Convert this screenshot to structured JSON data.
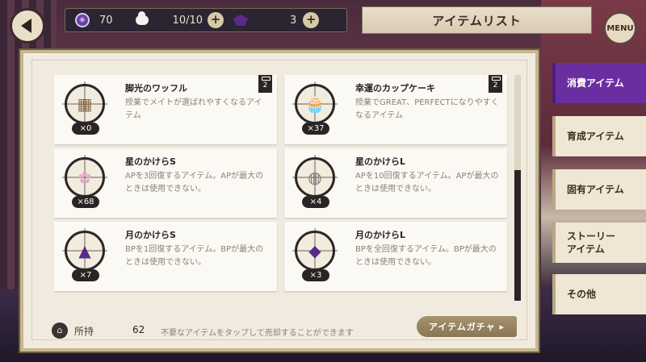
{
  "header": {
    "title": "アイテムリスト",
    "menu_label": "MENU",
    "orb_value": "70",
    "orb_symbol": "✳",
    "stamina_value": "10/10",
    "gem_value": "3",
    "plus_label": "+"
  },
  "items": [
    {
      "name": "脚光のワッフル",
      "desc": "授業でメイトが選ばれやすくなるアイテム",
      "qty": "×0",
      "badge": "2",
      "icon": "waffle-icon",
      "glyph": "▦",
      "color": "#8a6a44"
    },
    {
      "name": "幸運のカップケーキ",
      "desc": "授業でGREAT、PERFECTになりやすくなるアイテム",
      "qty": "×37",
      "badge": "2",
      "icon": "cupcake-icon",
      "glyph": "🧁",
      "color": "#c98a7a"
    },
    {
      "name": "星のかけらS",
      "desc": "APを3回復するアイテム。APが最大のときは使用できない。",
      "qty": "×68",
      "icon": "star-fragment-s-icon",
      "glyph": "✿",
      "color": "#e8a6c8"
    },
    {
      "name": "星のかけらL",
      "desc": "APを10回復するアイテム。APが最大のときは使用できない。",
      "qty": "×4",
      "icon": "star-fragment-l-icon",
      "glyph": "◍",
      "color": "#7a7a7a"
    },
    {
      "name": "月のかけらS",
      "desc": "BPを1回復するアイテム。BPが最大のときは使用できない。",
      "qty": "×7",
      "icon": "moon-fragment-s-icon",
      "glyph": "▲",
      "color": "#5a2a8a"
    },
    {
      "name": "月のかけらL",
      "desc": "BPを全回復するアイテム。BPが最大のときは使用できない。",
      "qty": "×3",
      "icon": "moon-fragment-l-icon",
      "glyph": "◆",
      "color": "#5a2a8a"
    }
  ],
  "footer": {
    "owned_label": "所持",
    "owned_count": "62",
    "hint": "不要なアイテムをタップして売却することができます",
    "gacha_button": "アイテムガチャ ▸"
  },
  "tabs": [
    {
      "label": "消費アイテム",
      "active": true
    },
    {
      "label": "育成アイテム",
      "active": false
    },
    {
      "label": "固有アイテム",
      "active": false
    },
    {
      "label": "ストーリー\nアイテム",
      "active": false
    },
    {
      "label": "その他",
      "active": false
    }
  ],
  "scroll": {
    "position_fraction": 0.5
  }
}
